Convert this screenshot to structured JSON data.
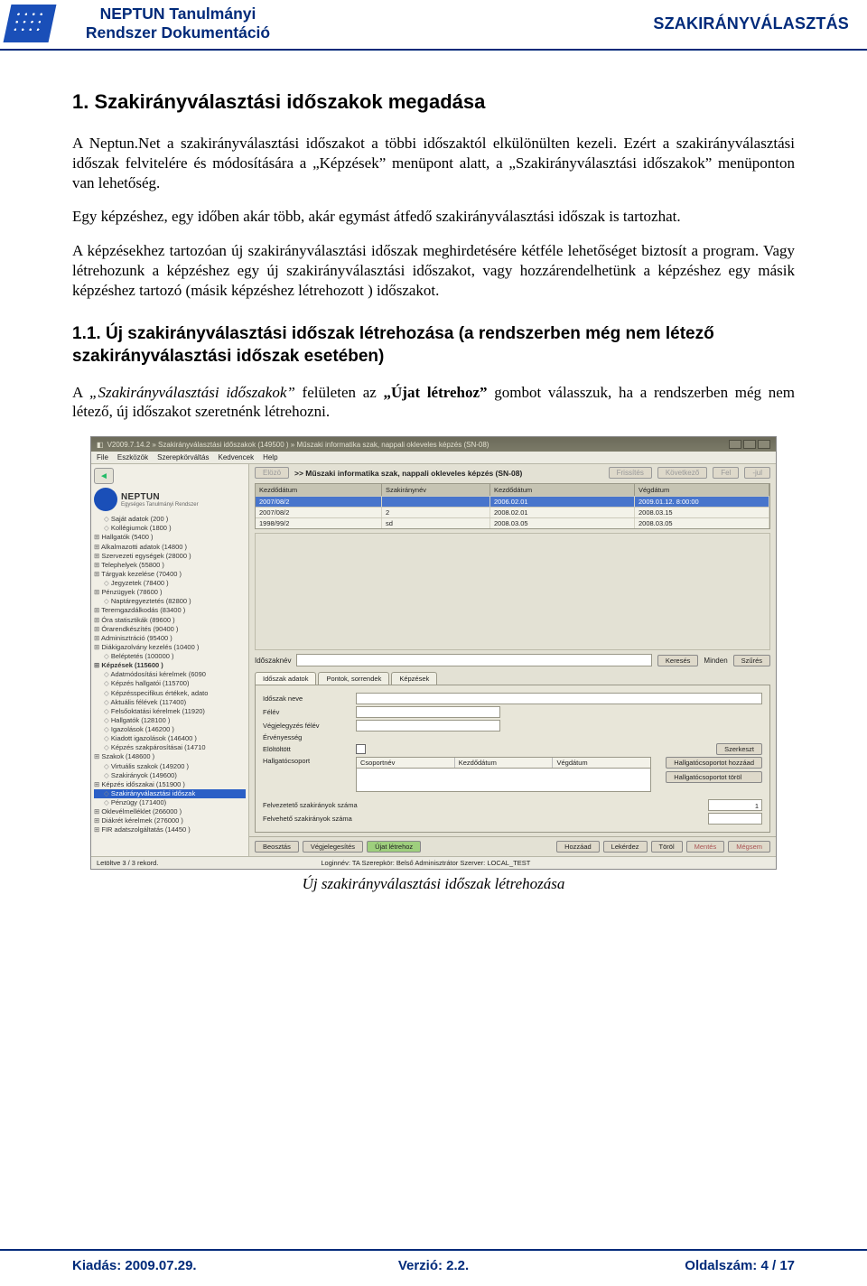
{
  "header": {
    "title_line1": "NEPTUN Tanulmányi",
    "title_line2": "Rendszer Dokumentáció",
    "right": "SZAKIRÁNYVÁLASZTÁS"
  },
  "h1": "1. Szakirányválasztási időszakok megadása",
  "p1": "A Neptun.Net a szakirányválasztási időszakot a többi időszaktól elkülönülten kezeli. Ezért a szakirányválasztási időszak felvitelére és módosítására a „Képzések” menüpont alatt, a „Szakirányválasztási időszakok” menüponton van lehetőség.",
  "p2": "Egy képzéshez, egy időben akár több, akár egymást átfedő szakirányválasztási időszak is tartozhat.",
  "p3": "A képzésekhez tartozóan új szakirányválasztási időszak meghirdetésére kétféle lehetőséget biztosít a program. Vagy létrehozunk a képzéshez egy új szakirányválasztási időszakot, vagy hozzárendelhetünk a képzéshez egy másik képzéshez tartozó (másik képzéshez létrehozott ) időszakot.",
  "h2": "1.1. Új szakirányválasztási időszak létrehozása (a rendszerben még nem létező szakirányválasztási időszak esetében)",
  "p4_a": "A ",
  "p4_italic": "„Szakirányválasztási időszakok”",
  "p4_b": " felületen az ",
  "p4_bold": "„Újat létrehoz”",
  "p4_c": " gombot válasszuk, ha a rendszerben még nem létező, új időszakot szeretnénk létrehozni.",
  "shot": {
    "title": "V2009.7.14.2 » Szakirányválasztási időszakok (149500 ) » Műszaki informatika szak, nappali okleveles képzés (SN-08)",
    "menus": [
      "File",
      "Eszközök",
      "Szerepkörváltás",
      "Kedvencek",
      "Help"
    ],
    "brand": "NEPTUN",
    "brand_sub": "Egységes Tanulmányi Rendszer",
    "back_btn": "Elözö",
    "path": ">> Műszaki informatika szak, nappali okleveles képzés (SN-08)",
    "top_right": [
      "Frissítés",
      "Következő",
      "Fel",
      "-jul"
    ],
    "tree": [
      {
        "t": "Saját adatok (200  )",
        "c": "lvl2n"
      },
      {
        "t": "Kollégiumok (1800  )",
        "c": "lvl2n"
      },
      {
        "t": "Hallgatók (5400  )",
        "c": "lvl1"
      },
      {
        "t": "Alkalmazotti adatok (14800 )",
        "c": "lvl1"
      },
      {
        "t": "Szervezeti egységek (28000 )",
        "c": "lvl1"
      },
      {
        "t": "Telephelyek (55800 )",
        "c": "lvl1"
      },
      {
        "t": "Tárgyak kezelése (70400 )",
        "c": "lvl1"
      },
      {
        "t": "Jegyzetek (78400 )",
        "c": "lvl2n"
      },
      {
        "t": "Pénzügyek (78600 )",
        "c": "lvl1"
      },
      {
        "t": "Naptáregyeztetés (82800 )",
        "c": "lvl2n"
      },
      {
        "t": "Teremgazdálkodás (83400 )",
        "c": "lvl1"
      },
      {
        "t": "Óra statisztikák (89600 )",
        "c": "lvl1"
      },
      {
        "t": "Órarendkészítés (90400 )",
        "c": "lvl1"
      },
      {
        "t": "Adminisztráció (95400 )",
        "c": "lvl1"
      },
      {
        "t": "Diákigazolvány kezelés (10400 )",
        "c": "lvl1"
      },
      {
        "t": "Beléptetés (100000 )",
        "c": "lvl2n"
      },
      {
        "t": "Képzések (115600 )",
        "c": "lvl1 bold"
      },
      {
        "t": "Adatmódosítási kérelmek (6090",
        "c": "lvl2n"
      },
      {
        "t": "Képzés hallgatói (115700)",
        "c": "lvl2n"
      },
      {
        "t": "Képzésspecifikus értékek, adato",
        "c": "lvl2n"
      },
      {
        "t": "Aktuális félévek (117400)",
        "c": "lvl2n"
      },
      {
        "t": "Felsőoktatási kérelmek (11920)",
        "c": "lvl2n"
      },
      {
        "t": "Hallgatók (128100 )",
        "c": "lvl2n"
      },
      {
        "t": "Igazolások (146200 )",
        "c": "lvl2n"
      },
      {
        "t": "Kiadott igazolások (146400 )",
        "c": "lvl2n"
      },
      {
        "t": "Képzés szakpárosításai (14710",
        "c": "lvl2n"
      },
      {
        "t": "Szakok (148600 )",
        "c": "lvl1"
      },
      {
        "t": "Virtuális szakok (149200 )",
        "c": "lvl2n"
      },
      {
        "t": "Szakirányok (149600)",
        "c": "lvl2n"
      },
      {
        "t": "Képzés időszakai (151900 )",
        "c": "lvl1"
      },
      {
        "t": "Szakirányválasztási időszak",
        "c": "lvl2n sel"
      },
      {
        "t": "Pénzügy (171400)",
        "c": "lvl2n"
      },
      {
        "t": "Oklevélmelléklet (266000 )",
        "c": "lvl1"
      },
      {
        "t": "Diákrét kérelmek (276000 )",
        "c": "lvl1"
      },
      {
        "t": "FIR adatszolgáltatás (14450 )",
        "c": "lvl1"
      }
    ],
    "grid_headers": [
      "Kezdődátum",
      "Szakiránynév",
      "Kezdődátum",
      "Végdátum"
    ],
    "grid_rows": [
      {
        "sel": true,
        "cells": [
          "2007/08/2",
          "",
          "2006.02.01",
          "2009.01.12. 8:00:00"
        ]
      },
      {
        "sel": false,
        "cells": [
          "2007/08/2",
          "2",
          "2008.02.01",
          "2008.03.15"
        ]
      },
      {
        "sel": false,
        "cells": [
          "1998/99/2",
          "sd",
          "2008.03.05",
          "2008.03.05"
        ]
      }
    ],
    "search_label": "Időszaknév",
    "search_btn": "Keresés",
    "search_all": "Minden",
    "search_right": "Szűrés",
    "tabs": [
      "Időszak adatok",
      "Pontok, sorrendek",
      "Képzések"
    ],
    "form": {
      "r1": "Időszak neve",
      "r2": "Félév",
      "r3": "Végjelegyzés félév",
      "r4": "Érvényesség",
      "r5": "Elöltöltött",
      "r6": "Hallgatócsoport",
      "sub_labels": [
        "Csoportnév",
        "Kezdődátum",
        "Végdátum"
      ],
      "right_btns": [
        "Szerkeszt",
        "Hallgatócsoportot hozzáad",
        "Hallgatócsoportot töröl"
      ],
      "bottom1": "Felvezetető szakirányok száma",
      "bottom2": "Felvehető szakirányok száma",
      "val": "1"
    },
    "footer_left": [
      "Beosztás",
      "Végjelegesítés"
    ],
    "footer_green": "Újat létrehoz",
    "footer_right": [
      "Hozzáad",
      "Lekérdez",
      "Töröl",
      "Mentés",
      "Mégsem"
    ],
    "status_left": "Letöltve 3 / 3 rekord.",
    "status_mid": "Loginnév: TA Szerepkör: Belső Adminisztrátor  Szerver: LOCAL_TEST"
  },
  "caption": "Új szakirányválasztási időszak létrehozása",
  "footer": {
    "left": "Kiadás: 2009.07.29.",
    "center": "Verzió: 2.2.",
    "right": "Oldalszám: 4 / 17"
  }
}
